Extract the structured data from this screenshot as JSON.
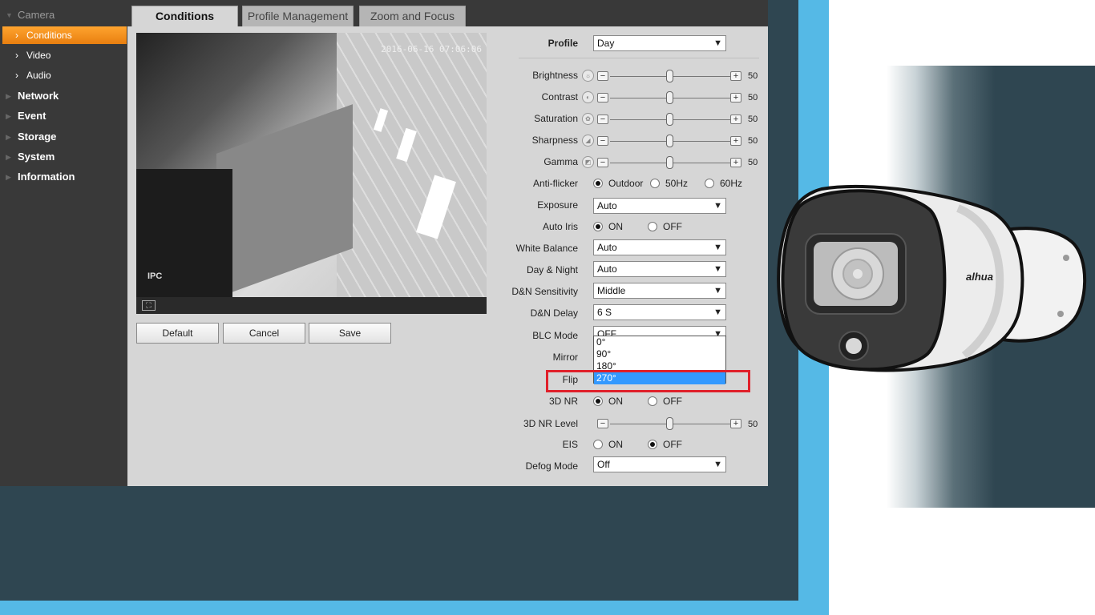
{
  "sidebar": {
    "items": [
      {
        "label": "Camera",
        "expanded": true
      },
      {
        "label": "Network"
      },
      {
        "label": "Event"
      },
      {
        "label": "Storage"
      },
      {
        "label": "System"
      },
      {
        "label": "Information"
      }
    ],
    "camera_sub": [
      {
        "label": "Conditions",
        "active": true
      },
      {
        "label": "Video"
      },
      {
        "label": "Audio"
      }
    ]
  },
  "tabs": [
    {
      "label": "Conditions",
      "active": true
    },
    {
      "label": "Profile Management"
    },
    {
      "label": "Zoom and Focus"
    }
  ],
  "video": {
    "timestamp": "2016-06-16 07:06:06",
    "overlay_text": "IPC"
  },
  "buttons": {
    "default": "Default",
    "cancel": "Cancel",
    "save": "Save"
  },
  "settings": {
    "profile": {
      "label": "Profile",
      "value": "Day"
    },
    "brightness": {
      "label": "Brightness",
      "value": "50"
    },
    "contrast": {
      "label": "Contrast",
      "value": "50"
    },
    "saturation": {
      "label": "Saturation",
      "value": "50"
    },
    "sharpness": {
      "label": "Sharpness",
      "value": "50"
    },
    "gamma": {
      "label": "Gamma",
      "value": "50"
    },
    "anti_flicker": {
      "label": "Anti-flicker",
      "options": [
        "Outdoor",
        "50Hz",
        "60Hz"
      ],
      "selected": "Outdoor"
    },
    "exposure": {
      "label": "Exposure",
      "value": "Auto"
    },
    "auto_iris": {
      "label": "Auto Iris",
      "options": [
        "ON",
        "OFF"
      ],
      "selected": "ON"
    },
    "white_balance": {
      "label": "White Balance",
      "value": "Auto"
    },
    "day_night": {
      "label": "Day & Night",
      "value": "Auto"
    },
    "dn_sensitivity": {
      "label": "D&N Sensitivity",
      "value": "Middle"
    },
    "dn_delay": {
      "label": "D&N Delay",
      "value": "6 S"
    },
    "blc_mode": {
      "label": "BLC Mode",
      "value": "OFF"
    },
    "mirror": {
      "label": "Mirror"
    },
    "flip": {
      "label": "Flip",
      "options": [
        "0°",
        "90°",
        "180°",
        "270°"
      ],
      "selected": "270°"
    },
    "nr3d": {
      "label": "3D NR",
      "options": [
        "ON",
        "OFF"
      ],
      "selected": "ON"
    },
    "nr3d_level": {
      "label": "3D NR Level",
      "value": "50"
    },
    "eis": {
      "label": "EIS",
      "options": [
        "ON",
        "OFF"
      ],
      "selected": "OFF"
    },
    "defog": {
      "label": "Defog Mode",
      "value": "Off"
    }
  },
  "product": {
    "brand": "alhua"
  },
  "colors": {
    "accent_orange": "#f29117",
    "highlight_red": "#e0202a",
    "frame_blue": "#55b9e6",
    "background_dark": "#2f4651"
  }
}
